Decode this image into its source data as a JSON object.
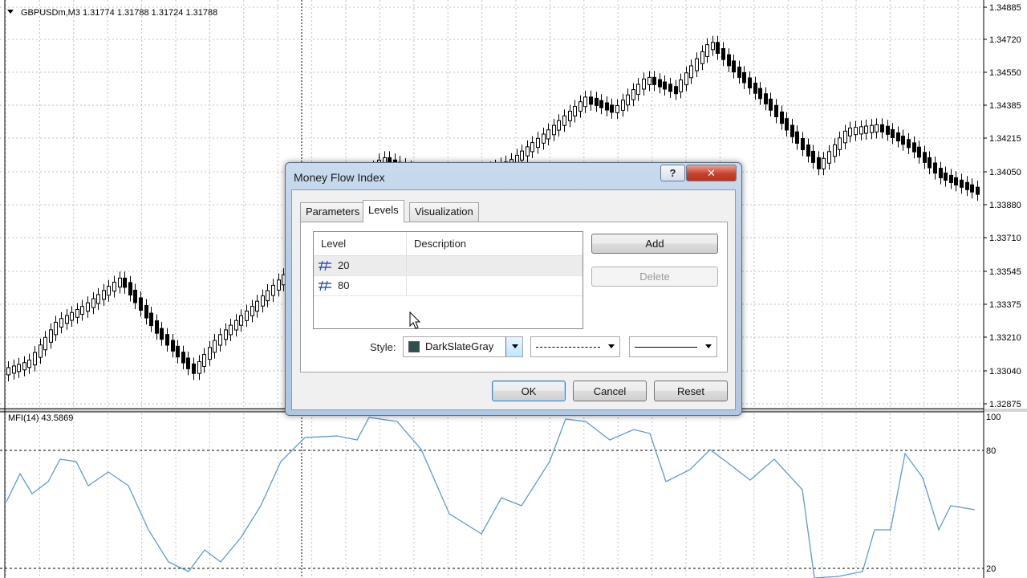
{
  "chart": {
    "symbol_info": "GBPUSDm,M3  1.31774 1.31788 1.31724 1.31788",
    "price_labels": [
      "1.34885",
      "1.34720",
      "1.34550",
      "1.34385",
      "1.34215",
      "1.34050",
      "1.33880",
      "1.33710",
      "1.33545",
      "1.33375",
      "1.33210",
      "1.33040",
      "1.32875"
    ],
    "indicator_info": "MFI(14) 43.5869",
    "indicator_labels": [
      "100",
      "80",
      "20"
    ],
    "colors": {
      "candle": "#000000",
      "grid": "#c0c0c0",
      "mfi_line": "#5b9bd5",
      "level_line": "#000000"
    }
  },
  "dialog": {
    "title": "Money Flow Index",
    "help_label": "?",
    "close_label": "✕",
    "tabs": [
      {
        "label": "Parameters",
        "active": false
      },
      {
        "label": "Levels",
        "active": true
      },
      {
        "label": "Visualization",
        "active": false
      }
    ],
    "table": {
      "columns": [
        "Level",
        "Description"
      ],
      "rows": [
        {
          "level": "20",
          "description": "",
          "selected": true
        },
        {
          "level": "80",
          "description": "",
          "selected": false
        }
      ]
    },
    "add_label": "Add",
    "delete_label": "Delete",
    "style_label": "Style:",
    "color_value": "DarkSlateGray",
    "color_hex": "#2f4f4f",
    "ok_label": "OK",
    "cancel_label": "Cancel",
    "reset_label": "Reset"
  }
}
